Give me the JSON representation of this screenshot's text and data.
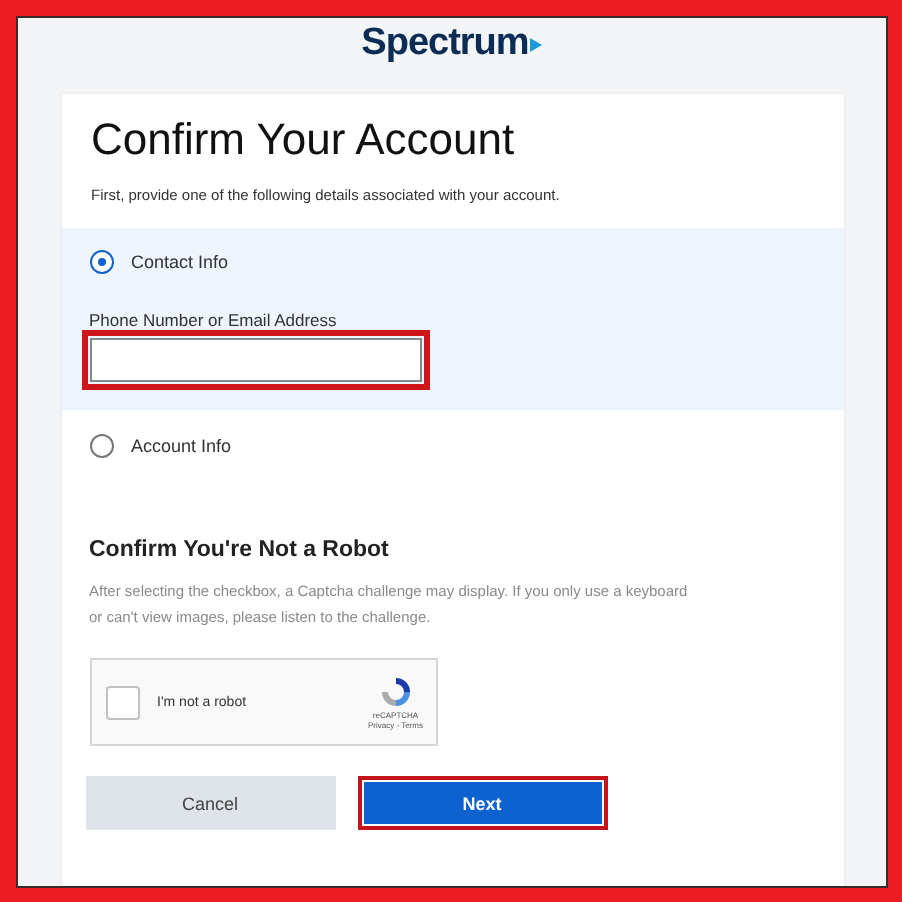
{
  "logo": "Spectrum",
  "title": "Confirm Your Account",
  "subtitle": "First, provide one of the following details associated with your account.",
  "options": [
    {
      "label": "Contact Info",
      "selected": true,
      "field": {
        "label": "Phone Number or Email Address",
        "highlighted": true
      }
    },
    {
      "label": "Account Info",
      "selected": false
    }
  ],
  "robot": {
    "heading": "Confirm You're Not a Robot",
    "description": "After selecting the checkbox, a Captcha challenge may display. If you only use a keyboard or can't view images, please listen to the challenge.",
    "checkbox_label": "I'm not a robot",
    "checked": false,
    "brand": "reCAPTCHA",
    "links": "Privacy - Terms"
  },
  "buttons": [
    {
      "label": "Cancel",
      "kind": "secondary",
      "highlighted": false
    },
    {
      "label": "Next",
      "kind": "primary",
      "highlighted": true
    }
  ]
}
